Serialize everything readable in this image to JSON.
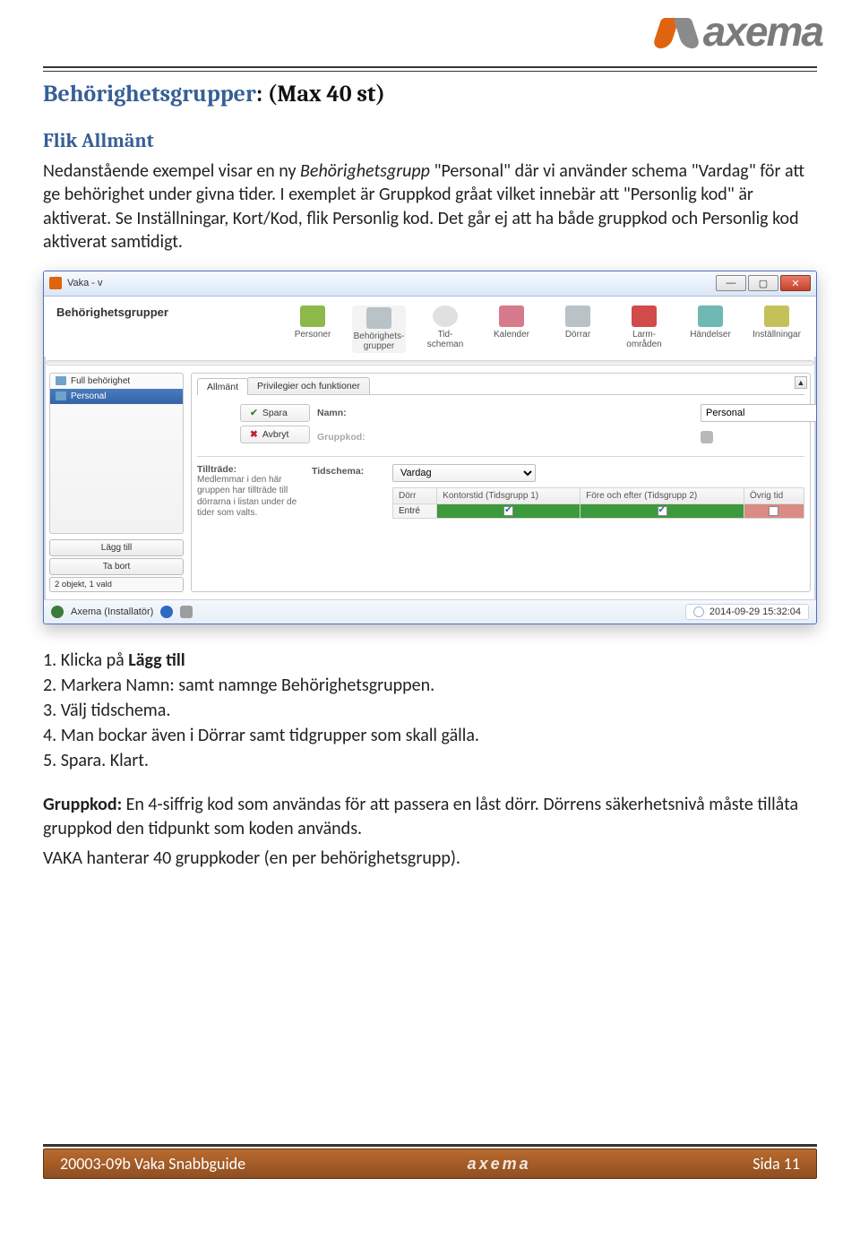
{
  "logo_text": "axema",
  "heading_accent": "Behörighetsgrupper",
  "heading_rest": ": (Max 40 st)",
  "subhead": "Flik Allmänt",
  "para1_a": "Nedanstående exempel visar en ny ",
  "para1_i": "Behörighetsgrupp",
  "para1_b": " \"Personal\" där vi använder schema \"Vardag\" för att ge behörighet under givna tider. I exemplet är Gruppkod gråat vilket innebär att \"Personlig kod\" är aktiverat. Se Inställningar, Kort/Kod, flik Personlig kod. Det går ej att ha både gruppkod och Personlig kod aktiverat samtidigt.",
  "app": {
    "title": "Vaka - v",
    "header": "Behörighetsgrupper",
    "nav": [
      "Personer",
      "Behörighets-\ngrupper",
      "Tid-\nscheman",
      "Kalender",
      "Dörrar",
      "Larm-\nområden",
      "Händelser",
      "Inställningar"
    ],
    "side_items": [
      "Full behörighet",
      "Personal"
    ],
    "side_selected_index": 1,
    "btn_add": "Lägg till",
    "btn_remove": "Ta bort",
    "side_status": "2 objekt, 1 vald",
    "tabs": [
      "Allmänt",
      "Privilegier och funktioner"
    ],
    "lbl_name": "Namn:",
    "val_name": "Personal",
    "lbl_group": "Gruppkod:",
    "btn_save": "Spara",
    "btn_cancel": "Avbryt",
    "lbl_access": "Tillträde:",
    "access_desc": "Medlemmar i den här gruppen har tillträde till dörrarna i listan under de tider som valts.",
    "lbl_schedule": "Tidschema:",
    "val_schedule": "Vardag",
    "th_door": "Dörr",
    "th_t1": "Kontorstid (Tidsgrupp 1)",
    "th_t2": "Före och efter (Tidsgrupp 2)",
    "th_other": "Övrig tid",
    "row_door": "Entré",
    "sb_user": "Axema (Installatör)",
    "sb_time": "2014-09-29 15:32:04"
  },
  "steps": [
    {
      "pre": "1. Klicka på ",
      "b": "Lägg till",
      "post": ""
    },
    {
      "pre": "2. Markera Namn: samt namnge Behörighetsgruppen.",
      "b": "",
      "post": ""
    },
    {
      "pre": "3. Välj tidschema.",
      "b": "",
      "post": ""
    },
    {
      "pre": "4. Man bockar även i Dörrar samt tidgrupper som skall gälla.",
      "b": "",
      "post": ""
    },
    {
      "pre": "5. Spara. Klart.",
      "b": "",
      "post": ""
    }
  ],
  "note_b": "Gruppkod:",
  "note_rest": " En 4-siffrig kod som användas för att passera en låst dörr. Dörrens säkerhetsnivå måste tillåta gruppkod den tidpunkt som koden används.",
  "note2": "VAKA hanterar 40 gruppkoder (en per behörighetsgrupp).",
  "footer_left": "20003-09b Vaka Snabbguide",
  "footer_mid": "axema",
  "footer_right": "Sida 11"
}
